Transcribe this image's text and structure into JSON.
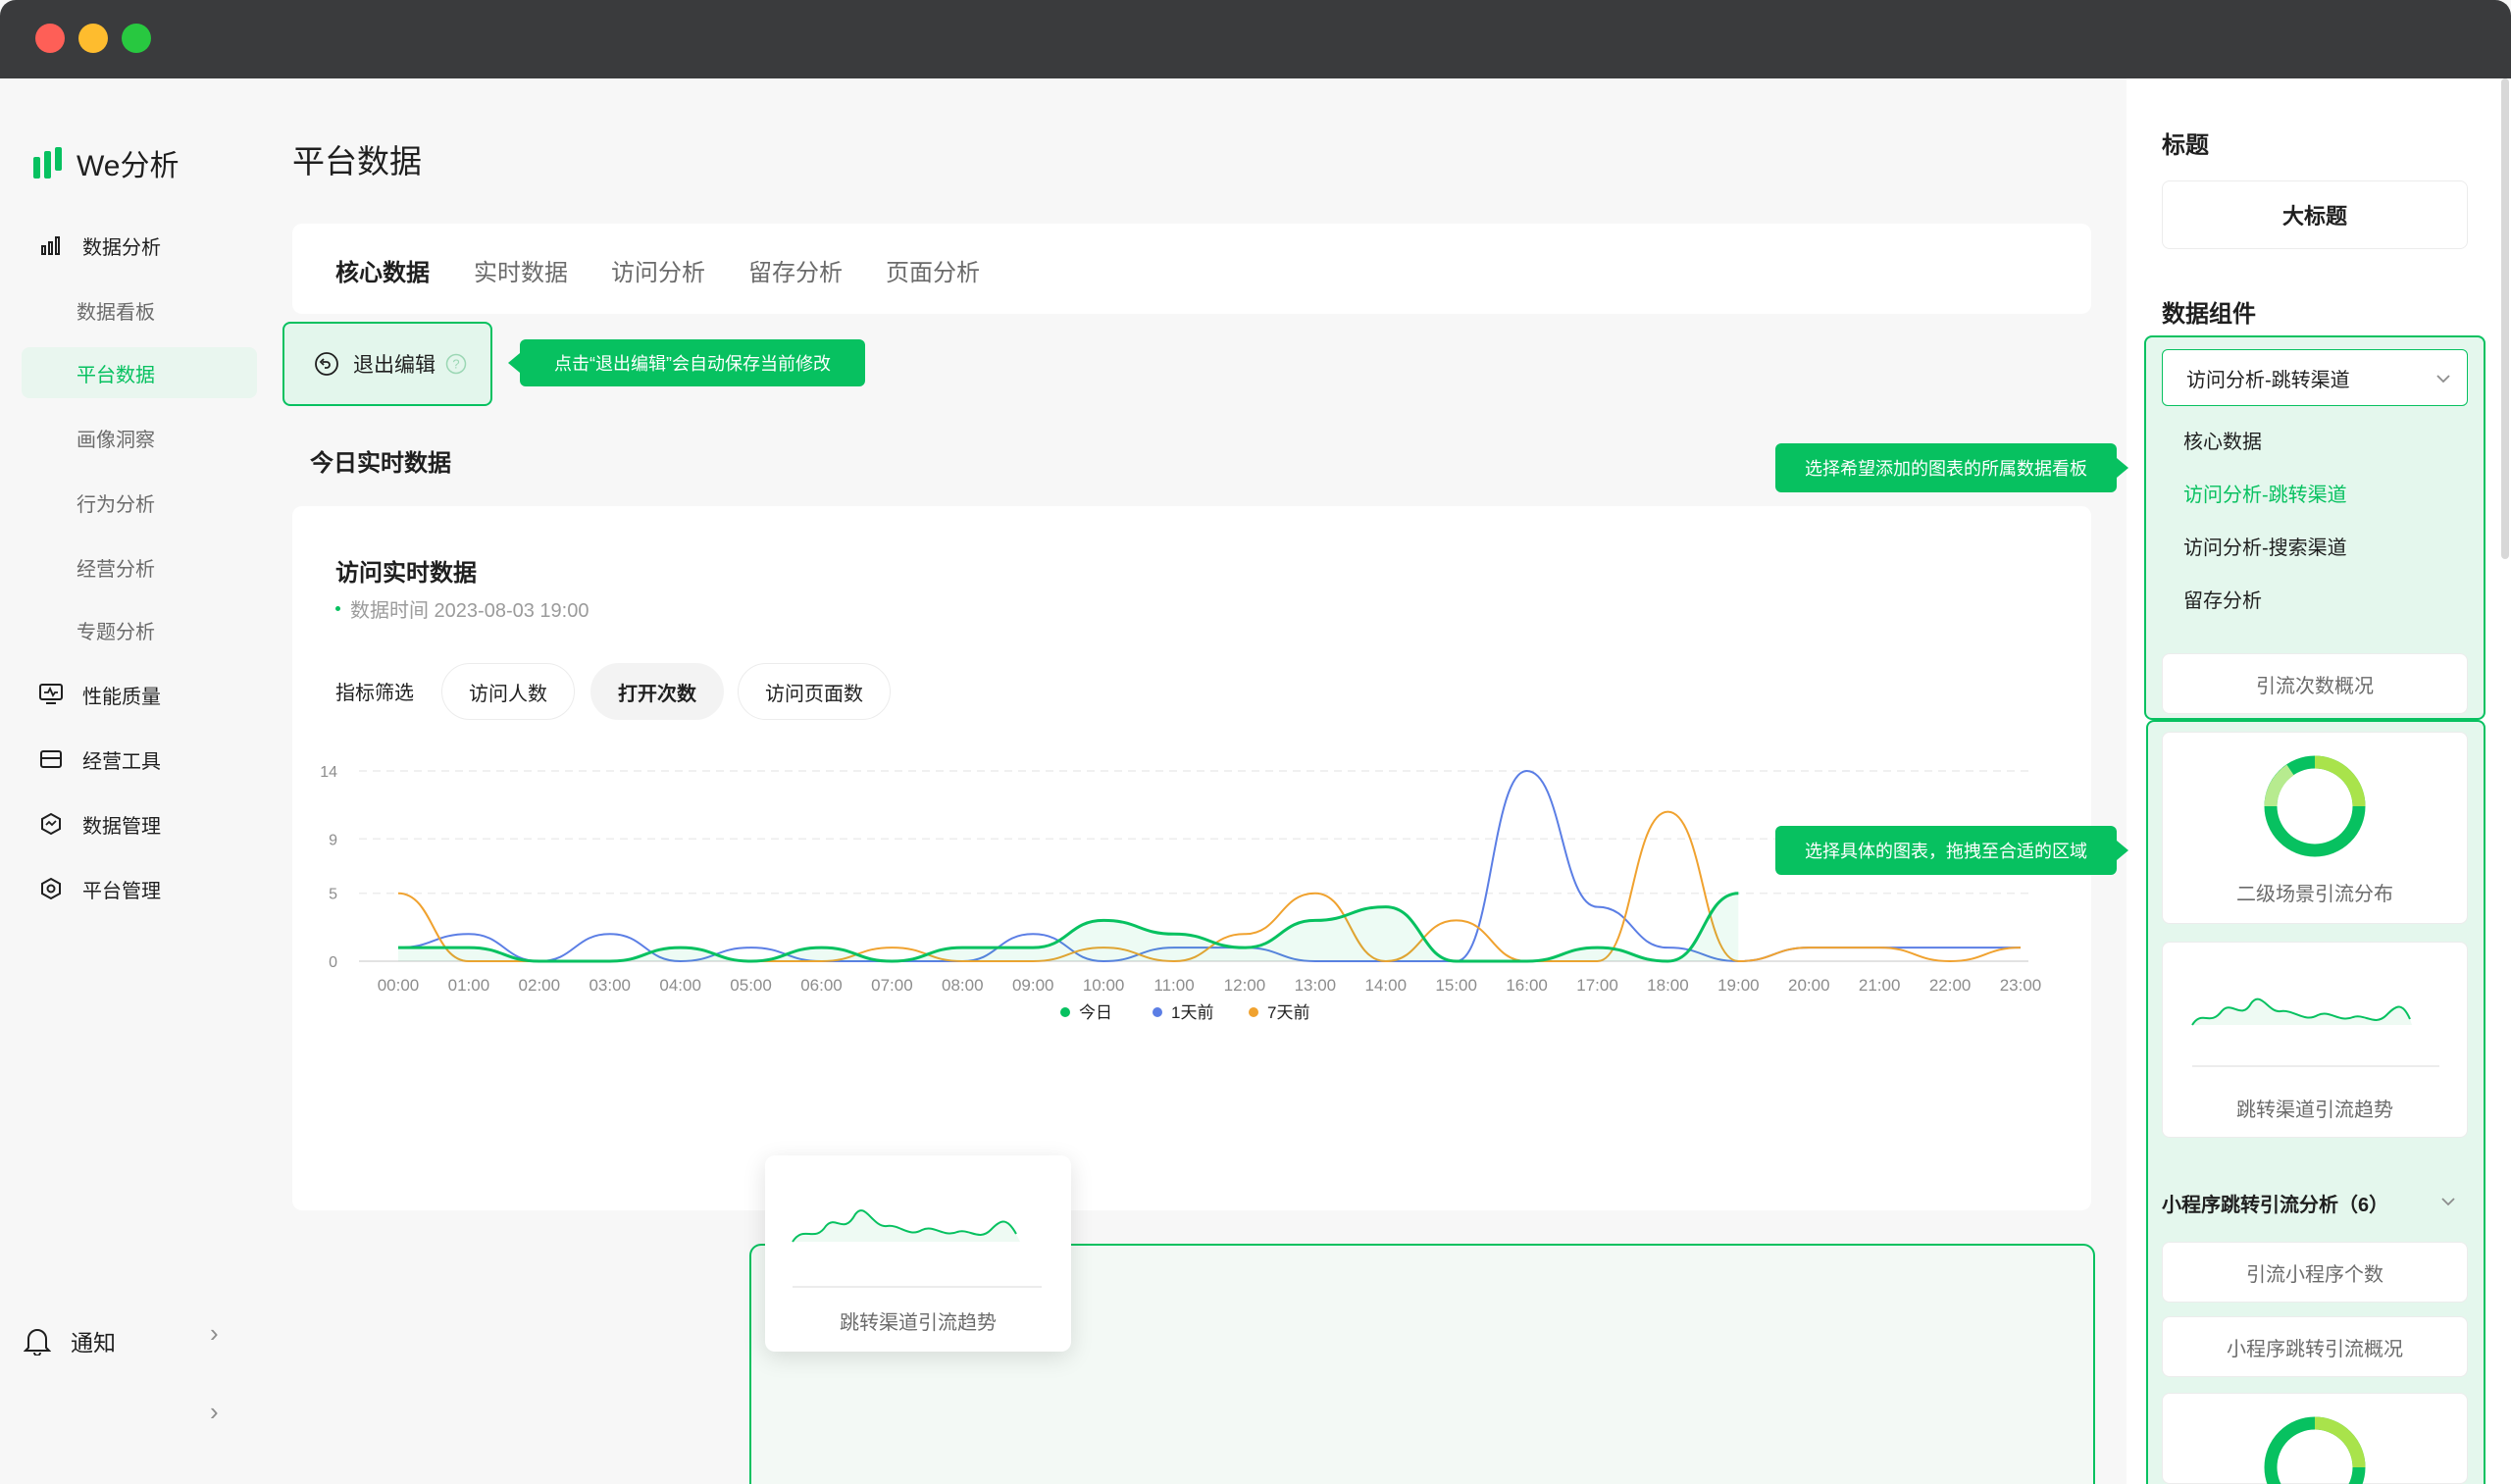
{
  "app": {
    "brand": "We分析"
  },
  "sidebar": {
    "items": [
      {
        "label": "数据分析",
        "icon": "bar-chart-icon"
      },
      {
        "label": "数据看板"
      },
      {
        "label": "平台数据"
      },
      {
        "label": "画像洞察"
      },
      {
        "label": "行为分析"
      },
      {
        "label": "经营分析"
      },
      {
        "label": "专题分析"
      },
      {
        "label": "性能质量",
        "icon": "monitor-icon"
      },
      {
        "label": "经营工具",
        "icon": "toolbox-icon"
      },
      {
        "label": "数据管理",
        "icon": "data-hex-icon"
      },
      {
        "label": "平台管理",
        "icon": "settings-hex-icon"
      }
    ],
    "notify": "通知"
  },
  "main": {
    "title": "平台数据",
    "tabs": [
      "核心数据",
      "实时数据",
      "访问分析",
      "留存分析",
      "页面分析"
    ],
    "exit_edit": "退出编辑",
    "exit_tip": "点击“退出编辑”会自动保存当前修改",
    "section_title": "今日实时数据",
    "card": {
      "title": "访问实时数据",
      "time": "数据时间 2023-08-03 19:00",
      "filter_label": "指标筛选",
      "chips": [
        "访问人数",
        "打开次数",
        "访问页面数"
      ]
    },
    "drag_card_label": "跳转渠道引流趋势"
  },
  "chart_data": {
    "type": "line",
    "x": [
      "00:00",
      "01:00",
      "02:00",
      "03:00",
      "04:00",
      "05:00",
      "06:00",
      "07:00",
      "08:00",
      "09:00",
      "10:00",
      "11:00",
      "12:00",
      "13:00",
      "14:00",
      "15:00",
      "16:00",
      "17:00",
      "18:00",
      "19:00",
      "20:00",
      "21:00",
      "22:00",
      "23:00"
    ],
    "yticks": [
      0,
      5,
      9,
      14
    ],
    "ylim": [
      0,
      14
    ],
    "series": [
      {
        "name": "今日",
        "color": "#07c160",
        "values": [
          1,
          1,
          0,
          0,
          1,
          0,
          1,
          0,
          1,
          1,
          3,
          2,
          1,
          3,
          4,
          0,
          0,
          1,
          0,
          5
        ]
      },
      {
        "name": "1天前",
        "color": "#5b7ee5",
        "values": [
          1,
          2,
          0,
          2,
          0,
          1,
          0,
          0,
          0,
          2,
          0,
          1,
          1,
          0,
          0,
          0,
          14,
          4,
          1,
          0,
          1,
          1,
          1,
          1
        ]
      },
      {
        "name": "7天前",
        "color": "#f0a22f",
        "values": [
          5,
          0,
          0,
          0,
          1,
          0,
          0,
          1,
          0,
          0,
          1,
          0,
          2,
          5,
          0,
          3,
          0,
          0,
          11,
          0,
          1,
          1,
          0,
          1
        ]
      }
    ],
    "legend_position": "bottom-center",
    "grid": true
  },
  "right_panel": {
    "title_heading": "标题",
    "title_value": "大标题",
    "components_heading": "数据组件",
    "select_value": "访问分析-跳转渠道",
    "options": [
      "核心数据",
      "访问分析-跳转渠道",
      "访问分析-搜索渠道",
      "留存分析"
    ],
    "tip_board": "选择希望添加的图表的所属数据看板",
    "tip_drag": "选择具体的图表，拖拽至合适的区域",
    "overview_1": "引流次数概况",
    "widget_1": "二级场景引流分布",
    "widget_2": "跳转渠道引流趋势",
    "group_title": "小程序跳转引流分析（6）",
    "widget_3": "引流小程序个数",
    "widget_4": "小程序跳转引流概况"
  }
}
